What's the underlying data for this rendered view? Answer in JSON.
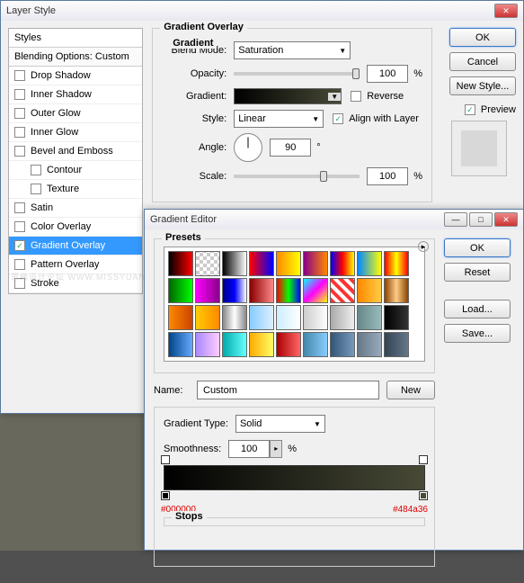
{
  "layer_style": {
    "title": "Layer Style",
    "styles_header": "Styles",
    "blending_sub": "Blending Options: Custom",
    "items": [
      {
        "label": "Drop Shadow",
        "checked": false,
        "indent": false
      },
      {
        "label": "Inner Shadow",
        "checked": false,
        "indent": false
      },
      {
        "label": "Outer Glow",
        "checked": false,
        "indent": false
      },
      {
        "label": "Inner Glow",
        "checked": false,
        "indent": false
      },
      {
        "label": "Bevel and Emboss",
        "checked": false,
        "indent": false
      },
      {
        "label": "Contour",
        "checked": false,
        "indent": true
      },
      {
        "label": "Texture",
        "checked": false,
        "indent": true
      },
      {
        "label": "Satin",
        "checked": false,
        "indent": false
      },
      {
        "label": "Color Overlay",
        "checked": false,
        "indent": false
      },
      {
        "label": "Gradient Overlay",
        "checked": true,
        "indent": false,
        "selected": true
      },
      {
        "label": "Pattern Overlay",
        "checked": false,
        "indent": false
      },
      {
        "label": "Stroke",
        "checked": false,
        "indent": false
      }
    ],
    "buttons": {
      "ok": "OK",
      "cancel": "Cancel",
      "new_style": "New Style...",
      "preview": "Preview"
    },
    "gradient_overlay": {
      "group_label": "Gradient Overlay",
      "sub_label": "Gradient",
      "blend_mode_label": "Blend Mode:",
      "blend_mode_value": "Saturation",
      "opacity_label": "Opacity:",
      "opacity_value": "100",
      "pct": "%",
      "gradient_label": "Gradient:",
      "reverse_label": "Reverse",
      "style_label": "Style:",
      "style_value": "Linear",
      "align_label": "Align with Layer",
      "angle_label": "Angle:",
      "angle_value": "90",
      "deg": "°",
      "scale_label": "Scale:",
      "scale_value": "100"
    }
  },
  "gradient_editor": {
    "title": "Gradient Editor",
    "presets_label": "Presets",
    "name_label": "Name:",
    "name_value": "Custom",
    "new_btn": "New",
    "type_label": "Gradient Type:",
    "type_value": "Solid",
    "smoothness_label": "Smoothness:",
    "smoothness_value": "100",
    "pct": "%",
    "stops_label": "Stops",
    "stop_left": "#000000",
    "stop_right": "#484a36",
    "buttons": {
      "ok": "OK",
      "reset": "Reset",
      "load": "Load...",
      "save": "Save..."
    },
    "preset_gradients": [
      "linear-gradient(90deg,#000,#f00)",
      "repeating-conic-gradient(#ccc 0 25%,#fff 0 50%) 0/8px 8px",
      "linear-gradient(90deg,#000,#fff)",
      "linear-gradient(90deg,#f00,#00f)",
      "linear-gradient(90deg,#f80,#ff0)",
      "linear-gradient(90deg,#808,#f80)",
      "linear-gradient(90deg,#00f,#f00,#ff0)",
      "linear-gradient(90deg,#08f,#ff0)",
      "linear-gradient(90deg,#f00,#ff0,#f00)",
      "linear-gradient(90deg,#060,#0f0)",
      "linear-gradient(90deg,#f0f,#808)",
      "linear-gradient(90deg,#008,#00f,#fff)",
      "linear-gradient(90deg,#800,#f88)",
      "linear-gradient(90deg,#f00,#0f0,#00f)",
      "linear-gradient(135deg,#0ff,#f0f,#ff0)",
      "repeating-linear-gradient(45deg,#f33 0 4px,#fff 4px 8px)",
      "linear-gradient(90deg,#f80,#fc4)",
      "linear-gradient(90deg,#840,#fc8,#840)",
      "linear-gradient(90deg,#f80,#c40)",
      "linear-gradient(90deg,#fc0,#f80)",
      "linear-gradient(90deg,#888,#fff,#888)",
      "linear-gradient(90deg,#8cf,#def)",
      "linear-gradient(90deg,#cef,#fff)",
      "linear-gradient(90deg,#ccc,#fff)",
      "linear-gradient(90deg,#aaa,#eee)",
      "linear-gradient(90deg,#688,#9bb)",
      "linear-gradient(90deg,#000,#333)",
      "linear-gradient(90deg,#048,#6af)",
      "linear-gradient(90deg,#a8f,#fcf)",
      "linear-gradient(90deg,#0aa,#6ff)",
      "linear-gradient(90deg,#fa0,#ff6)",
      "linear-gradient(90deg,#a00,#f66)",
      "linear-gradient(90deg,#48a,#8cf)",
      "linear-gradient(90deg,#357,#79b)",
      "linear-gradient(90deg,#678,#9ab)",
      "linear-gradient(90deg,#345,#678)"
    ]
  },
  "watermark": "思缘设计论坛  WWW.MISSYUAN.COM"
}
